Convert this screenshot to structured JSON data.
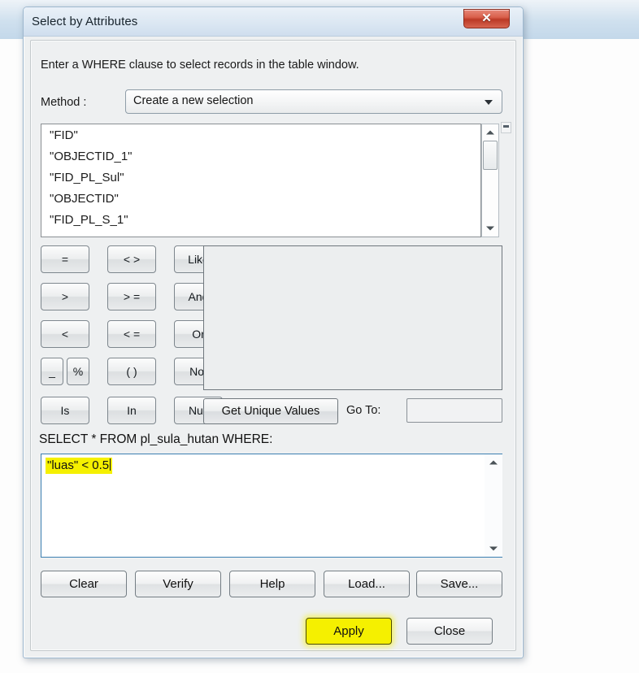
{
  "window": {
    "title": "Select by Attributes",
    "close_label": "✕",
    "close_icon": "close-icon"
  },
  "content": {
    "instruction": "Enter a WHERE clause to select records in the table window.",
    "method_label": "Method :",
    "method_value": "Create a new selection"
  },
  "fields": [
    "\"FID\"",
    "\"OBJECTID_1\"",
    "\"FID_PL_Sul\"",
    "\"OBJECTID\"",
    "\"FID_PL_S_1\""
  ],
  "operators": {
    "row1": [
      "=",
      "< >",
      "Like"
    ],
    "row2": [
      ">",
      "> =",
      "And"
    ],
    "row3": [
      "<",
      "< =",
      "Or"
    ],
    "row4_half": [
      "_",
      "%"
    ],
    "row4": [
      "( )",
      "Not"
    ],
    "row5": [
      "Is",
      "In",
      "Null"
    ]
  },
  "unique": {
    "get_unique_label": "Get Unique Values",
    "goto_label": "Go To:",
    "goto_value": "",
    "values": []
  },
  "query": {
    "select_line": "SELECT * FROM pl_sula_hutan WHERE:",
    "where_text": "\"luas\" < 0.5"
  },
  "buttons": {
    "clear": "Clear",
    "verify": "Verify",
    "help": "Help",
    "load": "Load...",
    "save": "Save...",
    "apply": "Apply",
    "close": "Close"
  },
  "colors": {
    "highlight": "#f5f000",
    "close_red": "#bb3a26",
    "focus_blue": "#3c7fb1"
  }
}
